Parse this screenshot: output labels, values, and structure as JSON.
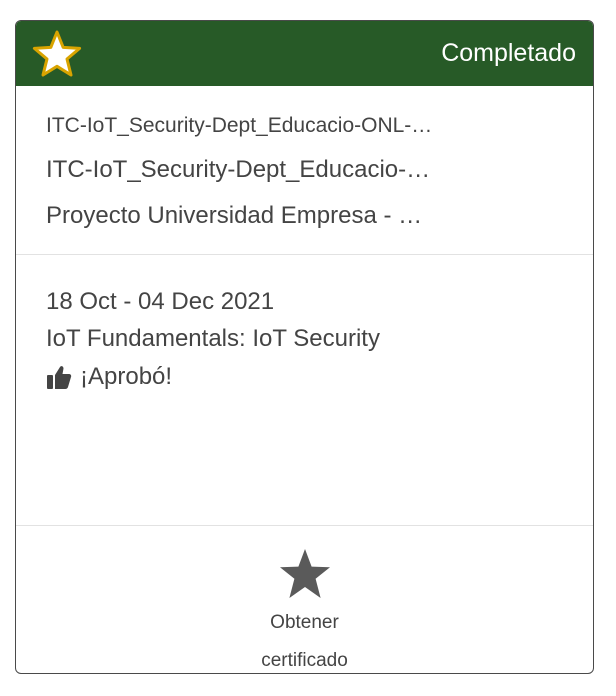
{
  "card": {
    "status": "Completado",
    "courses": [
      "ITC-IoT_Security-Dept_Educacio-ONL-…",
      "ITC-IoT_Security-Dept_Educacio-…",
      "Proyecto Universidad Empresa - …"
    ],
    "date_range": "18 Oct - 04 Dec 2021",
    "course_name": "IoT Fundamentals: IoT Security",
    "result": "¡Aprobó!",
    "certificate_label": "Obtener certificado",
    "icons": {
      "header": "star-icon",
      "result": "thumbs-up-icon",
      "certificate": "star-icon"
    },
    "colors": {
      "header_bg": "#275a27",
      "star_fill": "#ffffff",
      "star_outline": "#d9a400",
      "text": "#444444",
      "cert_star": "#5a5a5a"
    }
  }
}
